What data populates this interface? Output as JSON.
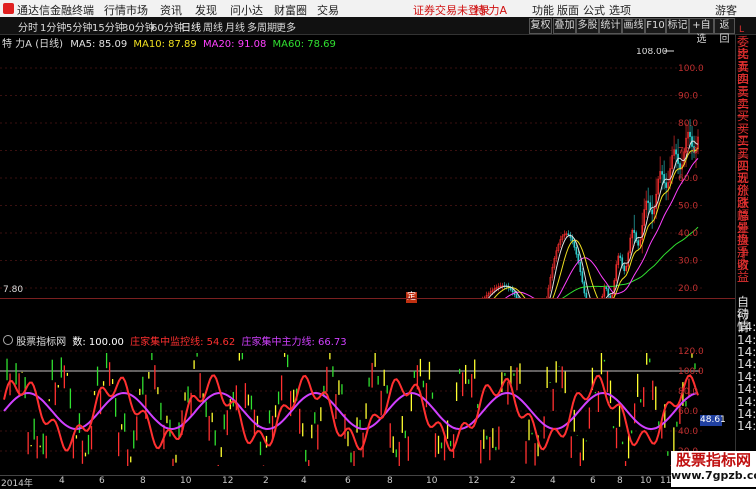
{
  "menu": {
    "app_name": "通达信金融终端",
    "items": [
      "行情",
      "市场",
      "资讯",
      "发现",
      "问小达",
      "财富圈",
      "交易"
    ],
    "warning": "证券交易未登录",
    "stock_name_top": "特 力A",
    "right_items": [
      "功能",
      "版面",
      "公式",
      "选项"
    ],
    "user": "游客"
  },
  "toolbar": {
    "periods": [
      "分时",
      "1分钟",
      "5分钟",
      "15分钟",
      "30分钟",
      "60分钟",
      "日线",
      "周线",
      "月线",
      "多周期",
      "更多"
    ],
    "selected": "日线",
    "buttons": [
      "复权",
      "叠加",
      "多股",
      "统计",
      "画线",
      "F10",
      "标记",
      "+自选",
      "返回"
    ]
  },
  "info": {
    "title": "特 力A (日线)",
    "ma5": "MA5: 85.09",
    "ma10": "MA10: 87.89",
    "ma20": "MA20: 91.08",
    "ma60": "MA60: 78.69",
    "colors": {
      "ma5": "#e0e0e0",
      "ma10": "#f0e020",
      "ma20": "#ff40ff",
      "ma60": "#30e030"
    }
  },
  "main_chart": {
    "high_label": "108.00",
    "low_label": "7.80",
    "marker": "定",
    "y_ticks": [
      "100.0",
      "90.0",
      "80.0",
      "70.0",
      "60.0",
      "50.0",
      "40.0",
      "30.0",
      "20.0"
    ]
  },
  "indicator": {
    "name": "股票指标网",
    "v1": "数: 100.00",
    "v2": "庄家集中监控线: 54.62",
    "v3": "庄家集中主力线: 66.73",
    "colors": {
      "v1": "#ffffff",
      "v2": "#ff3030",
      "v3": "#d040ff"
    },
    "y_ticks": [
      "120.0",
      "100.0",
      "80.0",
      "60.0",
      "40.0",
      "20.0"
    ],
    "current": "48.61"
  },
  "x_axis": {
    "labels": [
      "2014年",
      "4",
      "6",
      "8",
      "10",
      "12",
      "2",
      "4",
      "6",
      "8",
      "10",
      "12",
      "2",
      "4",
      "6",
      "8",
      "10",
      "11"
    ]
  },
  "right_panel": {
    "items": [
      "委比",
      "卖五",
      "卖四",
      "卖三",
      "卖二",
      "卖一",
      "买一",
      "买二",
      "买三",
      "买四",
      "买五",
      "现价",
      "涨跌",
      "涨幅",
      "总量",
      "外盘",
      "换手",
      "净资",
      "收益",
      "",
      "",
      "自动",
      "行情",
      "14:5",
      "14:5",
      "14:5",
      "14:5",
      "14:5",
      "14:5",
      "14:5",
      "14:5",
      "14:5"
    ],
    "top_label": "L"
  },
  "watermark": {
    "line1": "股票指标网",
    "line2": "www.7gpzb.com"
  }
}
